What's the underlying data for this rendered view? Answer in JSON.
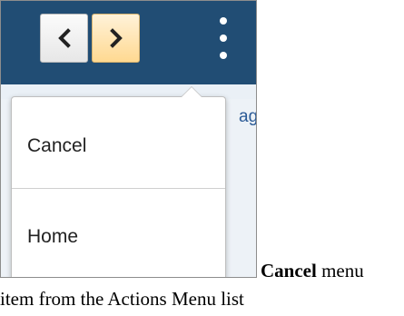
{
  "toolbar": {
    "prev_icon": "chevron-left-icon",
    "next_icon": "chevron-right-icon",
    "actions_icon": "kebab-vertical-icon",
    "colors": {
      "banner": "#214d74",
      "prev_button": "#f1f1f1",
      "next_button": "#ffe2a8"
    }
  },
  "background_page": {
    "partial_link_text": "ag"
  },
  "actions_menu": {
    "items": [
      {
        "label": "Cancel"
      },
      {
        "label": "Home"
      }
    ]
  },
  "caption": {
    "bold": "Cancel",
    "line1_rest": " menu",
    "line2": "item from the Actions Menu list"
  }
}
